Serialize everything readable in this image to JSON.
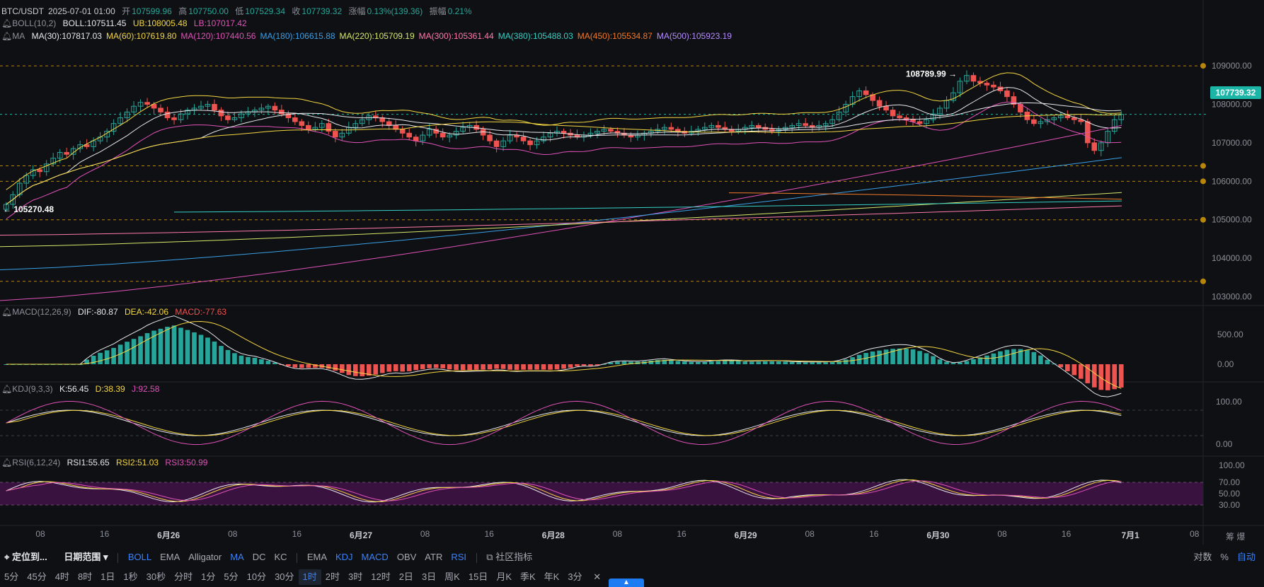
{
  "header": {
    "symbol": "BTC/USDT",
    "datetime": "2025-07-01 01:00",
    "open_label": "开",
    "open": "107599.96",
    "high_label": "高",
    "high": "107750.00",
    "low_label": "低",
    "low": "107529.34",
    "close_label": "收",
    "close": "107739.32",
    "change_label": "涨幅",
    "change": "0.13%(139.36)",
    "amp_label": "振幅",
    "amp": "0.21%"
  },
  "boll": {
    "name": "BOLL(10,2)",
    "boll": "BOLL:107511.45",
    "ub": "UB:108005.48",
    "lb": "LB:107017.42"
  },
  "ma": {
    "name": "MA",
    "items": [
      {
        "text": "MA(30):107817.03",
        "color": "#e6e8ec"
      },
      {
        "text": "MA(60):107619.80",
        "color": "#f5d742"
      },
      {
        "text": "MA(120):107440.56",
        "color": "#e052b8"
      },
      {
        "text": "MA(180):106615.88",
        "color": "#3aa0e8"
      },
      {
        "text": "MA(220):105709.19",
        "color": "#d8e86c"
      },
      {
        "text": "MA(300):105361.44",
        "color": "#ff7aa8"
      },
      {
        "text": "MA(380):105488.03",
        "color": "#34d1c6"
      },
      {
        "text": "MA(450):105534.87",
        "color": "#f07a2a"
      },
      {
        "text": "MA(500):105923.19",
        "color": "#b58cff"
      }
    ]
  },
  "macd": {
    "name": "MACD(12,26,9)",
    "dif": "DIF:-80.87",
    "dea": "DEA:-42.06",
    "macd": "MACD:-77.63"
  },
  "kdj": {
    "name": "KDJ(9,3,3)",
    "k": "K:56.45",
    "d": "D:38.39",
    "j": "J:92.58"
  },
  "rsi": {
    "name": "RSI(6,12,24)",
    "r1": "RSI1:55.65",
    "r2": "RSI2:51.03",
    "r3": "RSI3:50.99"
  },
  "price_tag": "107739.32",
  "annotations": {
    "high_marker": "108789.99",
    "low_marker": "105270.48"
  },
  "colors": {
    "up": "#26a69a",
    "down": "#ef5350",
    "boll_mid": "#e6e8ec",
    "boll_band": "#f5d742",
    "macd_dif": "#e6e8ec",
    "macd_dea": "#f5d742",
    "rsi_band": "#3a1240"
  },
  "x_axis": [
    {
      "label": "08",
      "day": false
    },
    {
      "label": "16",
      "day": false
    },
    {
      "label": "6月26",
      "day": true
    },
    {
      "label": "08",
      "day": false
    },
    {
      "label": "16",
      "day": false
    },
    {
      "label": "6月27",
      "day": true
    },
    {
      "label": "08",
      "day": false
    },
    {
      "label": "16",
      "day": false
    },
    {
      "label": "6月28",
      "day": true
    },
    {
      "label": "08",
      "day": false
    },
    {
      "label": "16",
      "day": false
    },
    {
      "label": "6月29",
      "day": true
    },
    {
      "label": "08",
      "day": false
    },
    {
      "label": "16",
      "day": false
    },
    {
      "label": "6月30",
      "day": true
    },
    {
      "label": "08",
      "day": false
    },
    {
      "label": "16",
      "day": false
    },
    {
      "label": "7月1",
      "day": true
    },
    {
      "label": "08",
      "day": false
    }
  ],
  "toolbar1": {
    "locate": "定位到...",
    "range": "日期范围",
    "main_indicators": [
      {
        "label": "BOLL",
        "active": true
      },
      {
        "label": "EMA",
        "active": false
      },
      {
        "label": "Alligator",
        "active": false
      },
      {
        "label": "MA",
        "active": true
      },
      {
        "label": "DC",
        "active": false
      },
      {
        "label": "KC",
        "active": false
      }
    ],
    "sub_indicators": [
      {
        "label": "EMA",
        "active": false
      },
      {
        "label": "KDJ",
        "active": true
      },
      {
        "label": "MACD",
        "active": true
      },
      {
        "label": "OBV",
        "active": false
      },
      {
        "label": "ATR",
        "active": false
      },
      {
        "label": "RSI",
        "active": true
      }
    ],
    "community": "社区指标",
    "scale": [
      {
        "label": "对数",
        "active": false
      },
      {
        "label": "%",
        "active": false
      },
      {
        "label": "自动",
        "active": true
      }
    ]
  },
  "toolbar2": {
    "intervals": [
      {
        "label": "5分",
        "active": false
      },
      {
        "label": "45分",
        "active": false
      },
      {
        "label": "4时",
        "active": false
      },
      {
        "label": "8时",
        "active": false
      },
      {
        "label": "1日",
        "active": false
      },
      {
        "label": "1秒",
        "active": false
      },
      {
        "label": "30秒",
        "active": false
      },
      {
        "label": "分时",
        "active": false
      },
      {
        "label": "1分",
        "active": false
      },
      {
        "label": "5分",
        "active": false
      },
      {
        "label": "10分",
        "active": false
      },
      {
        "label": "30分",
        "active": false
      },
      {
        "label": "1时",
        "active": true
      },
      {
        "label": "2时",
        "active": false
      },
      {
        "label": "3时",
        "active": false
      },
      {
        "label": "12时",
        "active": false
      },
      {
        "label": "2日",
        "active": false
      },
      {
        "label": "3日",
        "active": false
      },
      {
        "label": "周K",
        "active": false
      },
      {
        "label": "15日",
        "active": false
      },
      {
        "label": "月K",
        "active": false
      },
      {
        "label": "季K",
        "active": false
      },
      {
        "label": "年K",
        "active": false
      },
      {
        "label": "3分",
        "active": false
      }
    ],
    "close": "✕"
  },
  "right_corner": "筹 爆",
  "chart_data": {
    "type": "candlestick",
    "interval": "1时",
    "main_y_ticks": [
      "109000.00",
      "108000.00",
      "107000.00",
      "106000.00",
      "105000.00",
      "104000.00",
      "103000.00"
    ],
    "main_y_range": [
      102900,
      109700
    ],
    "high_marker": {
      "value": 108789.99,
      "index": 143
    },
    "low_marker": {
      "value": 105270.48,
      "index": 0
    },
    "candles_close": [
      105400,
      105650,
      105950,
      106150,
      106300,
      106250,
      106450,
      106600,
      106750,
      106700,
      106850,
      106950,
      106900,
      107050,
      107150,
      107300,
      107500,
      107650,
      107800,
      107950,
      108050,
      108000,
      107900,
      107800,
      107650,
      107600,
      107750,
      107850,
      107900,
      107950,
      108000,
      107850,
      107700,
      107600,
      107650,
      107750,
      107800,
      107850,
      107900,
      107950,
      107850,
      107750,
      107650,
      107550,
      107450,
      107350,
      107400,
      107500,
      107300,
      107150,
      107250,
      107400,
      107500,
      107600,
      107700,
      107650,
      107550,
      107450,
      107350,
      107250,
      107150,
      107050,
      107200,
      107350,
      107250,
      107150,
      107200,
      107300,
      107400,
      107450,
      107350,
      107200,
      107050,
      106900,
      107050,
      107200,
      107150,
      107050,
      106950,
      107050,
      107150,
      107250,
      107300,
      107250,
      107200,
      107150,
      107200,
      107250,
      107300,
      107350,
      107300,
      107250,
      107200,
      107150,
      107200,
      107250,
      107300,
      107350,
      107400,
      107350,
      107300,
      107250,
      107300,
      107350,
      107400,
      107450,
      107400,
      107350,
      107300,
      107350,
      107400,
      107450,
      107400,
      107350,
      107300,
      107350,
      107400,
      107450,
      107500,
      107450,
      107400,
      107450,
      107500,
      107600,
      107800,
      108000,
      108200,
      108350,
      108250,
      108100,
      107950,
      107850,
      107700,
      107650,
      107600,
      107550,
      107500,
      107600,
      107750,
      107900,
      108100,
      108300,
      108600,
      108750,
      108600,
      108550,
      108500,
      108450,
      108350,
      108200,
      108000,
      107800,
      107600,
      107500,
      107550,
      107600,
      107650,
      107700,
      107650,
      107600,
      107550,
      107000,
      106800,
      107000,
      107300,
      107600,
      107739
    ],
    "macd_y_ticks": [
      "500.00",
      "0.00"
    ],
    "kdj_y_ticks": [
      "100.00",
      "0.00"
    ],
    "rsi_y_ticks": [
      "100.00",
      "70.00",
      "50.00",
      "30.00"
    ]
  }
}
